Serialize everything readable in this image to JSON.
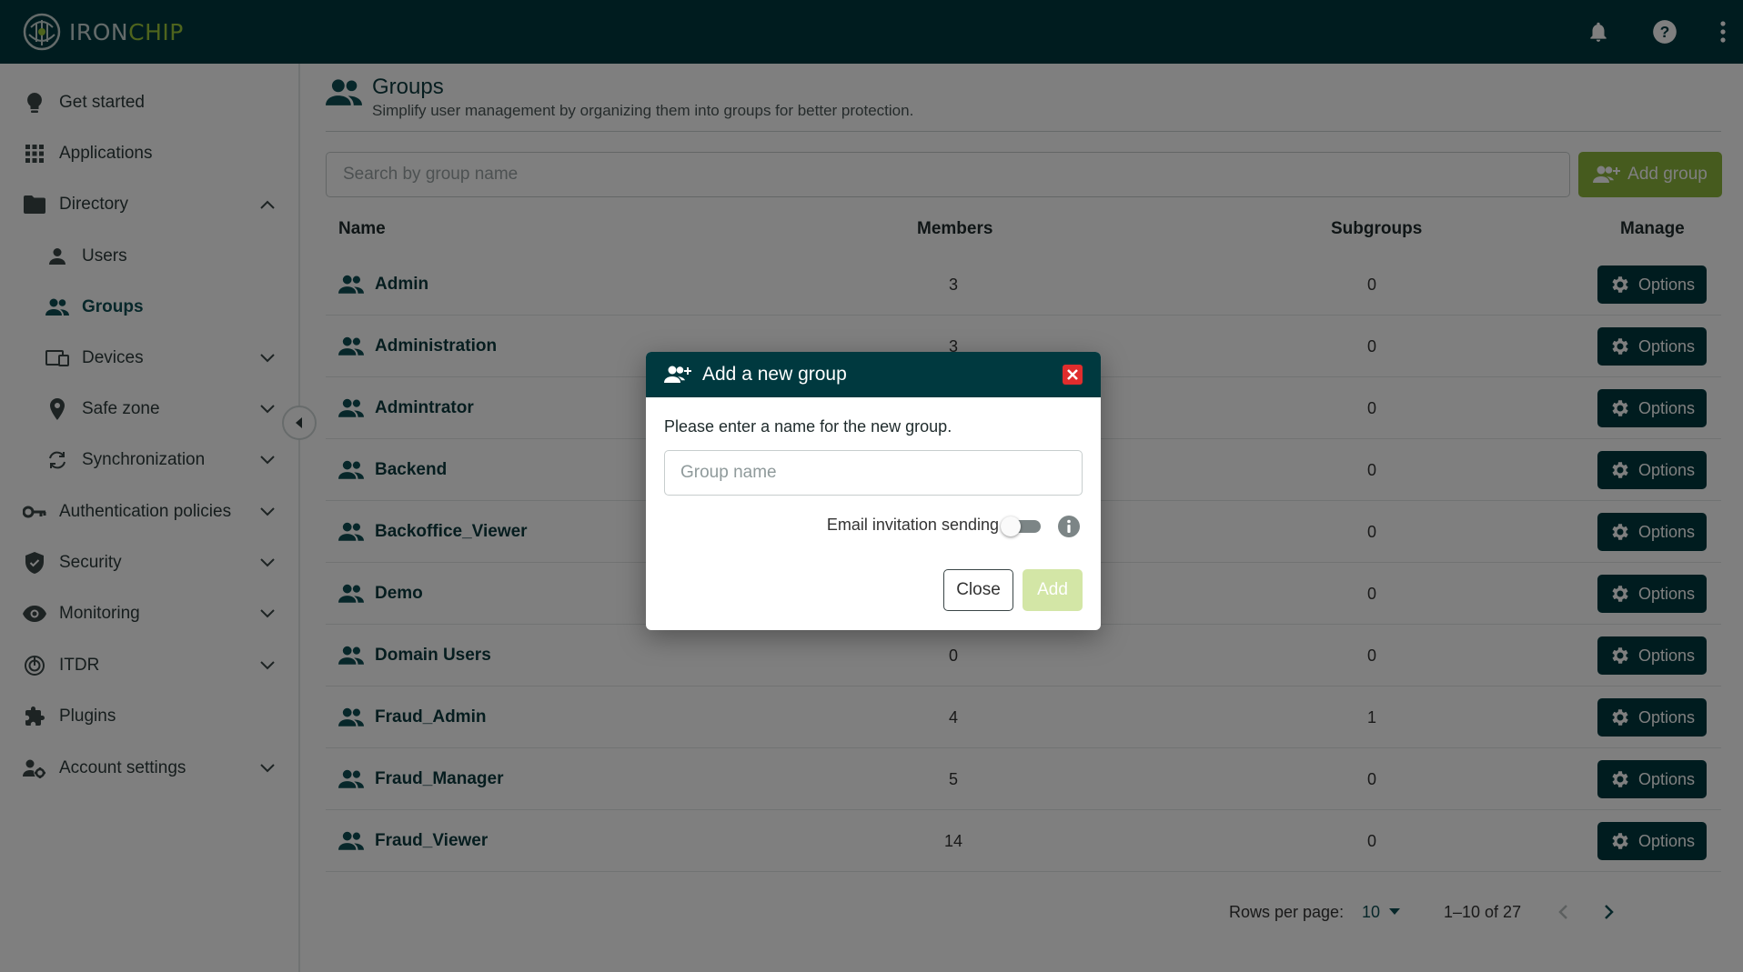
{
  "brand": {
    "name_part1": "IRON",
    "name_part2": "CHIP"
  },
  "topbar": {
    "icons": [
      "bell-icon",
      "help-icon",
      "more-vert-icon"
    ]
  },
  "sidebar": {
    "items": [
      {
        "label": "Get started",
        "icon": "lightbulb-icon"
      },
      {
        "label": "Applications",
        "icon": "apps-grid-icon"
      },
      {
        "label": "Directory",
        "icon": "folder-icon",
        "expanded": true
      },
      {
        "label": "Users",
        "icon": "person-icon"
      },
      {
        "label": "Groups",
        "icon": "group-icon",
        "active": true
      },
      {
        "label": "Devices",
        "icon": "devices-icon"
      },
      {
        "label": "Safe zone",
        "icon": "location-pin-icon"
      },
      {
        "label": "Synchronization",
        "icon": "sync-icon"
      },
      {
        "label": "Authentication policies",
        "icon": "key-icon"
      },
      {
        "label": "Security",
        "icon": "shield-icon"
      },
      {
        "label": "Monitoring",
        "icon": "eye-icon"
      },
      {
        "label": "ITDR",
        "icon": "itdr-icon"
      },
      {
        "label": "Plugins",
        "icon": "puzzle-icon"
      },
      {
        "label": "Account settings",
        "icon": "user-settings-icon"
      }
    ]
  },
  "page": {
    "title": "Groups",
    "subtitle": "Simplify user management by organizing them into groups for better protection."
  },
  "search": {
    "placeholder": "Search by group name",
    "value": ""
  },
  "add_group_label": "Add group",
  "table": {
    "headers": {
      "name": "Name",
      "members": "Members",
      "subgroups": "Subgroups",
      "manage": "Manage"
    },
    "option_label": "Options",
    "rows": [
      {
        "name": "Admin",
        "members": "3",
        "subgroups": "0"
      },
      {
        "name": "Administration",
        "members": "3",
        "subgroups": "0"
      },
      {
        "name": "Admintrator",
        "members": "",
        "subgroups": "0"
      },
      {
        "name": "Backend",
        "members": "",
        "subgroups": "0"
      },
      {
        "name": "Backoffice_Viewer",
        "members": "",
        "subgroups": "0"
      },
      {
        "name": "Demo",
        "members": "",
        "subgroups": "0"
      },
      {
        "name": "Domain Users",
        "members": "0",
        "subgroups": "0"
      },
      {
        "name": "Fraud_Admin",
        "members": "4",
        "subgroups": "1"
      },
      {
        "name": "Fraud_Manager",
        "members": "5",
        "subgroups": "0"
      },
      {
        "name": "Fraud_Viewer",
        "members": "14",
        "subgroups": "0"
      }
    ]
  },
  "pagination": {
    "rows_label": "Rows per page:",
    "rows_value": "10",
    "range": "1–10 of 27"
  },
  "modal": {
    "title": "Add a new group",
    "prompt": "Please enter a name for the new group.",
    "input_placeholder": "Group name",
    "input_value": "",
    "toggle_label": "Email invitation sending",
    "toggle_on": false,
    "close_label": "Close",
    "add_label": "Add"
  },
  "colors": {
    "primary": "#00393f",
    "accent": "#8cb63c",
    "danger": "#e02d2d"
  }
}
